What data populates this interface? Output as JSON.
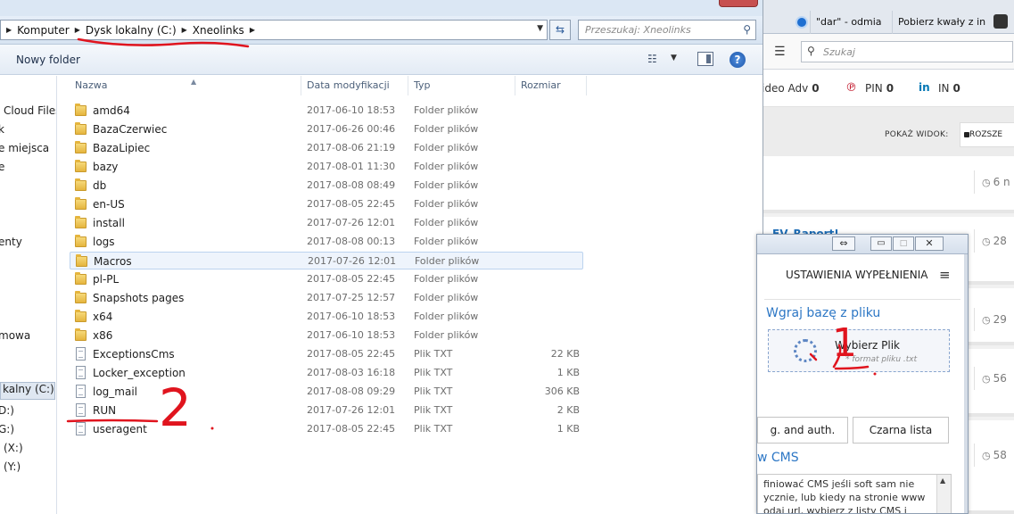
{
  "explorer": {
    "breadcrumbs": [
      "Komputer",
      "Dysk lokalny (C:)",
      "Xneolinks"
    ],
    "search_placeholder": "Przeszukaj: Xneolinks",
    "toolbar": {
      "new_folder": "Nowy folder"
    },
    "columns": {
      "name": "Nazwa",
      "date": "Data modyfikacji",
      "type": "Typ",
      "size": "Rozmiar"
    },
    "nav_items": [
      "Cloud Files",
      "k",
      "e miejsca",
      "e",
      "enty",
      "mowa",
      "kalny (C:)",
      "D:)",
      "G:)",
      "(X:)",
      "(Y:)"
    ],
    "files": [
      {
        "name": "amd64",
        "date": "2017-06-10 18:53",
        "type": "Folder plików",
        "size": "",
        "kind": "folder"
      },
      {
        "name": "BazaCzerwiec",
        "date": "2017-06-26 00:46",
        "type": "Folder plików",
        "size": "",
        "kind": "folder"
      },
      {
        "name": "BazaLipiec",
        "date": "2017-08-06 21:19",
        "type": "Folder plików",
        "size": "",
        "kind": "folder"
      },
      {
        "name": "bazy",
        "date": "2017-08-01 11:30",
        "type": "Folder plików",
        "size": "",
        "kind": "folder"
      },
      {
        "name": "db",
        "date": "2017-08-08 08:49",
        "type": "Folder plików",
        "size": "",
        "kind": "folder"
      },
      {
        "name": "en-US",
        "date": "2017-08-05 22:45",
        "type": "Folder plików",
        "size": "",
        "kind": "folder"
      },
      {
        "name": "install",
        "date": "2017-07-26 12:01",
        "type": "Folder plików",
        "size": "",
        "kind": "folder"
      },
      {
        "name": "logs",
        "date": "2017-08-08 00:13",
        "type": "Folder plików",
        "size": "",
        "kind": "folder"
      },
      {
        "name": "Macros",
        "date": "2017-07-26 12:01",
        "type": "Folder plików",
        "size": "",
        "kind": "folder"
      },
      {
        "name": "pl-PL",
        "date": "2017-08-05 22:45",
        "type": "Folder plików",
        "size": "",
        "kind": "folder"
      },
      {
        "name": "Snapshots pages",
        "date": "2017-07-25 12:57",
        "type": "Folder plików",
        "size": "",
        "kind": "folder"
      },
      {
        "name": "x64",
        "date": "2017-06-10 18:53",
        "type": "Folder plików",
        "size": "",
        "kind": "folder"
      },
      {
        "name": "x86",
        "date": "2017-06-10 18:53",
        "type": "Folder plików",
        "size": "",
        "kind": "folder"
      },
      {
        "name": "ExceptionsCms",
        "date": "2017-08-05 22:45",
        "type": "Plik TXT",
        "size": "22 KB",
        "kind": "txt"
      },
      {
        "name": "Locker_exception",
        "date": "2017-08-03 16:18",
        "type": "Plik TXT",
        "size": "1 KB",
        "kind": "txt"
      },
      {
        "name": "log_mail",
        "date": "2017-08-08 09:29",
        "type": "Plik TXT",
        "size": "306 KB",
        "kind": "txt"
      },
      {
        "name": "RUN",
        "date": "2017-07-26 12:01",
        "type": "Plik TXT",
        "size": "2 KB",
        "kind": "txt"
      },
      {
        "name": "useragent",
        "date": "2017-08-05 22:45",
        "type": "Plik TXT",
        "size": "1 KB",
        "kind": "txt"
      }
    ],
    "annotations": {
      "mark_2": "2"
    }
  },
  "browser": {
    "tabs": [
      "\"dar\" - odmia",
      "Pobierz kwały z in"
    ],
    "search_placeholder": "Szukaj",
    "share": {
      "video_label": "ideo Adv",
      "video_count": "0",
      "pin_label": "PIN",
      "pin_count": "0",
      "in_label": "IN",
      "in_count": "0"
    },
    "view_label": "POKAŻ WIDOK:",
    "view_option": "ROZSZE",
    "card_meta": [
      "6 n",
      "28",
      "29",
      "56",
      "58"
    ],
    "card_title": "EV_Raport!"
  },
  "popup": {
    "heading": "USTAWIENIA WYPEŁNIENIA",
    "upload_title": "Wgraj bazę z pliku",
    "dropzone_label": "Wybierz Plik",
    "dropzone_hint": "* format pliku .txt",
    "tabs": [
      "g. and auth.",
      "Czarna lista"
    ],
    "cms_title": "w CMS",
    "cms_text": "finiować CMS jeśli soft sam nie ycznie, lub kiedy na stronie www odaj url, wybierz z listy CMS i",
    "annotations": {
      "mark_1": "1"
    }
  },
  "colors": {
    "accent_blue": "#2d77c5",
    "annotation_red": "#e0141e",
    "folder": "#e5b53e"
  }
}
